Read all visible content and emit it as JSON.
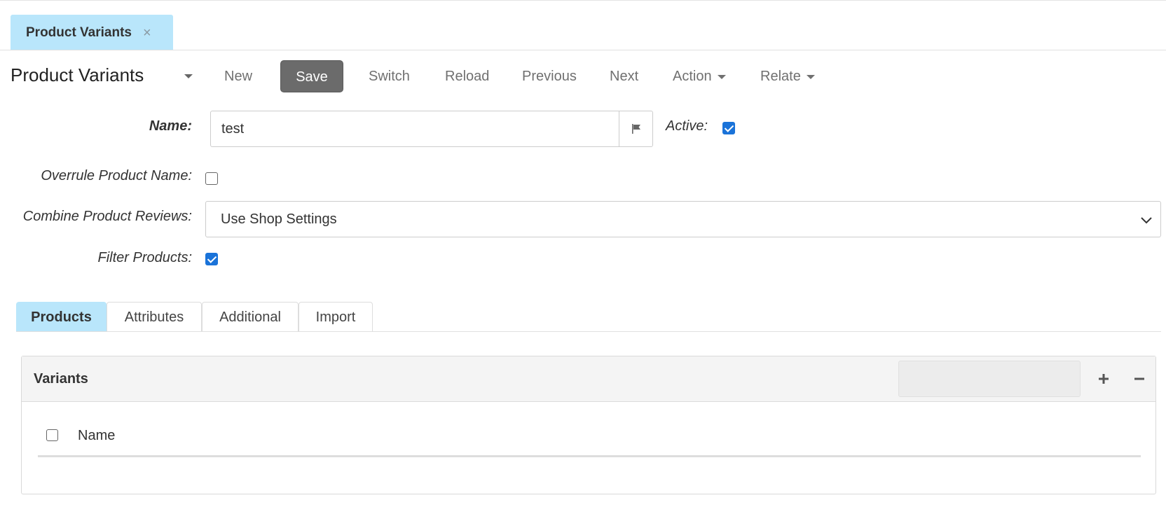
{
  "doc_tab": {
    "title": "Product Variants",
    "close": "×"
  },
  "toolbar": {
    "title": "Product Variants",
    "new": "New",
    "save": "Save",
    "switch": "Switch",
    "reload": "Reload",
    "previous": "Previous",
    "next": "Next",
    "action": "Action",
    "relate": "Relate"
  },
  "form": {
    "name_label": "Name:",
    "name_value": "test",
    "active_label": "Active:",
    "active_checked": true,
    "overrule_label": "Overrule Product Name:",
    "overrule_checked": false,
    "combine_label": "Combine Product Reviews:",
    "combine_value": "Use Shop Settings",
    "filter_label": "Filter Products:",
    "filter_checked": true
  },
  "tabs": [
    {
      "label": "Products",
      "active": true
    },
    {
      "label": "Attributes",
      "active": false
    },
    {
      "label": "Additional",
      "active": false
    },
    {
      "label": "Import",
      "active": false
    }
  ],
  "panel": {
    "title": "Variants",
    "columns": [
      "Name"
    ]
  },
  "icons": {
    "flag": "flag-icon",
    "add": "plus-icon",
    "remove": "minus-icon",
    "dropdown": "chevron-down-icon"
  },
  "colors": {
    "active_tab": "#b9e6fb",
    "save_button": "#6b6b6b",
    "checkbox": "#1a73d9"
  }
}
